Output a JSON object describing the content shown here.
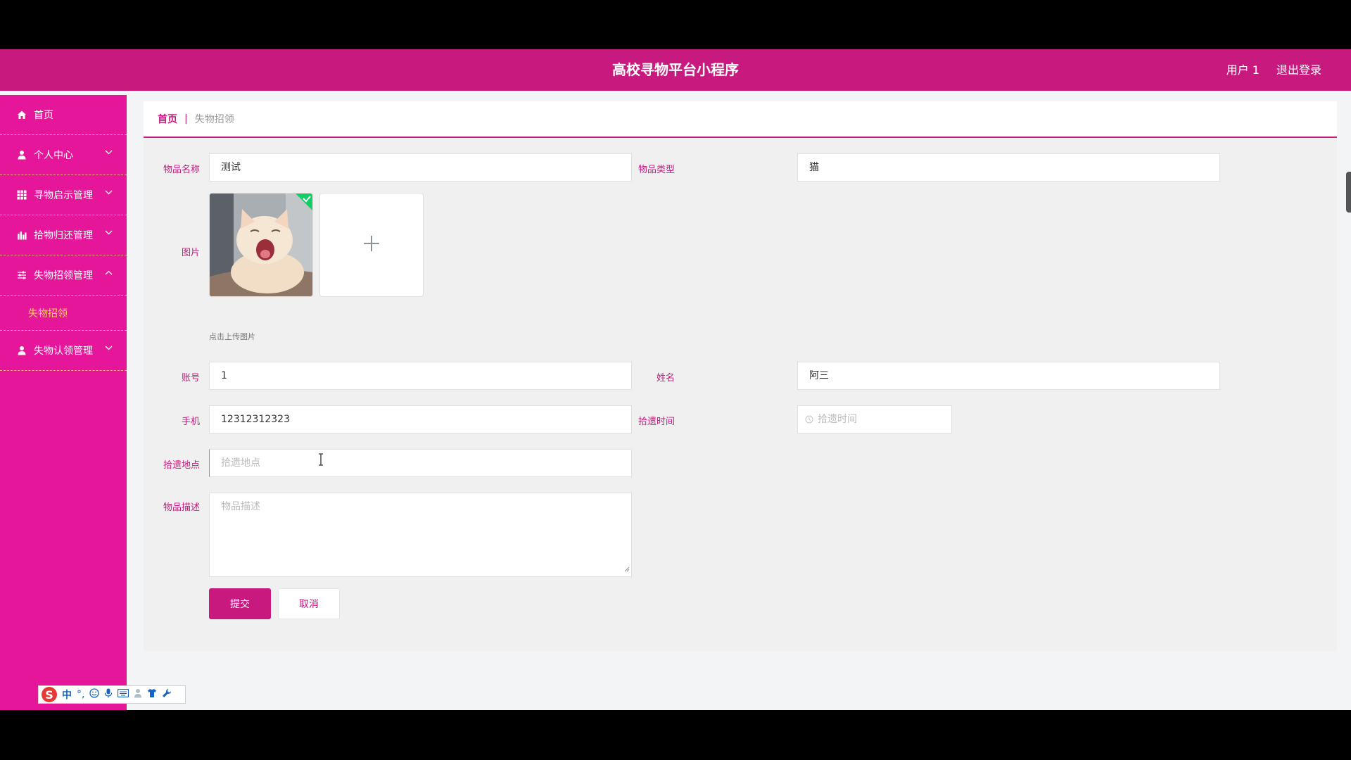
{
  "header": {
    "title": "高校寻物平台小程序",
    "user": "用户 1",
    "logout": "退出登录"
  },
  "sidebar": {
    "items": [
      {
        "label": "首页",
        "icon": "home-icon"
      },
      {
        "label": "个人中心",
        "icon": "user-icon"
      },
      {
        "label": "寻物启示管理",
        "icon": "grid-icon"
      },
      {
        "label": "拾物归还管理",
        "icon": "chart-icon"
      },
      {
        "label": "失物招领管理",
        "icon": "sliders-icon"
      },
      {
        "label": "失物认领管理",
        "icon": "user-icon"
      }
    ],
    "sub_item": "失物招领"
  },
  "breadcrumb": {
    "home": "首页",
    "separator": "|",
    "current": "失物招领"
  },
  "form": {
    "item_name": {
      "label": "物品名称",
      "value": "测试"
    },
    "item_type": {
      "label": "物品类型",
      "value": "猫"
    },
    "image": {
      "label": "图片",
      "hint": "点击上传图片"
    },
    "account": {
      "label": "账号",
      "value": "1"
    },
    "name": {
      "label": "姓名",
      "value": "阿三"
    },
    "phone": {
      "label": "手机",
      "value": "12312312323"
    },
    "pickup_time": {
      "label": "拾遗时间",
      "placeholder": "拾遗时间"
    },
    "pickup_place": {
      "label": "拾遗地点",
      "placeholder": "拾遗地点"
    },
    "description": {
      "label": "物品描述",
      "placeholder": "物品描述"
    },
    "submit": "提交",
    "cancel": "取消"
  },
  "ime": {
    "mode": "中",
    "punct": "°,"
  },
  "colors": {
    "brand": "#c8197f",
    "sidebar": "#e5169a",
    "active_sub": "#ffd35a"
  }
}
